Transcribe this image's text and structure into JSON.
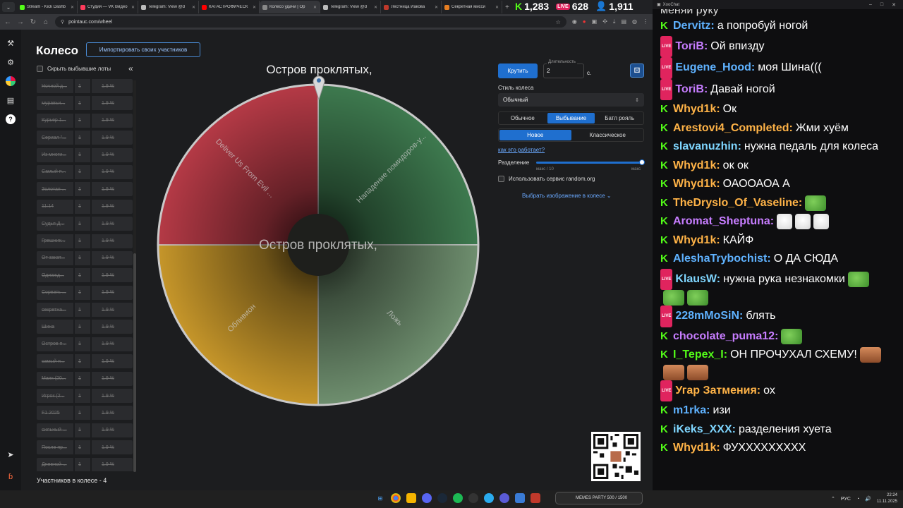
{
  "browser": {
    "tabs": [
      {
        "title": "Stream - Kick Dashb",
        "color": "#53fc18"
      },
      {
        "title": "Студия — VK Видео",
        "color": "#ff3b5c"
      },
      {
        "title": "Telegram: View @d",
        "color": "#bbbbbb"
      },
      {
        "title": "КАТАСТРОФИЧЕСК",
        "color": "#ff0000"
      },
      {
        "title": "Колесо удачи | Ор",
        "color": "#888888",
        "active": true
      },
      {
        "title": "Telegram: View @d",
        "color": "#bbbbbb"
      },
      {
        "title": "Лестница Иакова",
        "color": "#c0392b"
      },
      {
        "title": "Секретная мисси",
        "color": "#e67e22"
      }
    ],
    "url": "pointauc.com/wheel"
  },
  "stream_stats": {
    "kick_viewers": "1,283",
    "vk_viewers": "628",
    "total_viewers": "1,911"
  },
  "sidebar": {
    "page_title": "Колесо",
    "import_button": "Импортировать своих участников",
    "hide_lots_label": "Скрыть выбывшие лоты",
    "collapse_icon": "«",
    "lots": [
      {
        "name": "Ночной д...",
        "count": "1",
        "percent": "1.9 %"
      },
      {
        "name": "муравьи...",
        "count": "1",
        "percent": "1.9 %"
      },
      {
        "name": "Курьер 1...",
        "count": "1",
        "percent": "1.9 %"
      },
      {
        "name": "Сериал \"...",
        "count": "1",
        "percent": "1.9 %"
      },
      {
        "name": "Из многи...",
        "count": "1",
        "percent": "1.9 %"
      },
      {
        "name": "Самый п...",
        "count": "1",
        "percent": "1.9 %"
      },
      {
        "name": "Золотая ...",
        "count": "1",
        "percent": "1.9 %"
      },
      {
        "name": "11:14",
        "count": "1",
        "percent": "1.9 %"
      },
      {
        "name": "Судья Д...",
        "count": "1",
        "percent": "1.9 %"
      },
      {
        "name": "Грешник...",
        "count": "1",
        "percent": "1.9 %"
      },
      {
        "name": "От закат...",
        "count": "1",
        "percent": "1.9 %"
      },
      {
        "name": "Однажд...",
        "count": "1",
        "percent": "1.9 %"
      },
      {
        "name": "Сорвать ...",
        "count": "1",
        "percent": "1.9 %"
      },
      {
        "name": "секретна...",
        "count": "1",
        "percent": "1.9 %"
      },
      {
        "name": "Шина",
        "count": "1",
        "percent": "1.9 %"
      },
      {
        "name": "Остров п...",
        "count": "1",
        "percent": "1.9 %"
      },
      {
        "name": "самый п...",
        "count": "1",
        "percent": "1.9 %"
      },
      {
        "name": "Маяк (20...",
        "count": "1",
        "percent": "1.9 %"
      },
      {
        "name": "Игрок (2...",
        "count": "1",
        "percent": "1.9 %"
      },
      {
        "name": "F1 2025",
        "count": "1",
        "percent": "1.9 %"
      },
      {
        "name": "сильный ...",
        "count": "1",
        "percent": "1.9 %"
      },
      {
        "name": "После пр...",
        "count": "1",
        "percent": "1.9 %"
      },
      {
        "name": "Дневной ...",
        "count": "1",
        "percent": "1.9 %"
      }
    ],
    "participants_count": "Участников в колесе - 4"
  },
  "wheel": {
    "title": "Остров проклятых,",
    "center_text": "Остров проклятых,",
    "segments": [
      {
        "label": "Нападение помидоров-у...",
        "color": "#3e7a4f"
      },
      {
        "label": "Ложь",
        "color": "#6f8f6f"
      },
      {
        "label": "Обливион",
        "color": "#c6962a"
      },
      {
        "label": "Deliver Us From Evil ...",
        "color": "#b53a46"
      }
    ]
  },
  "controls": {
    "spin_button": "Крутить",
    "duration_label": "Длительность",
    "duration_value": "2",
    "duration_unit": "с.",
    "style_label": "Стиль колеса",
    "style_value": "Обычный",
    "modes": [
      "Обычное",
      "Выбывание",
      "Батл рояль"
    ],
    "active_mode": "Выбывание",
    "variants": [
      "Новое",
      "Классическое"
    ],
    "active_variant": "Новое",
    "how_link": "как это работает?",
    "split_label": "Разделение",
    "split_min": "макс / 10",
    "split_max": "макс",
    "split_value": 1.0,
    "random_org_label": "Использовать сервис random.org",
    "image_select": "Выбрать изображение в колесе"
  },
  "chat": {
    "window_title": "XooChat",
    "top_partial": "меняи руку",
    "messages": [
      {
        "platform": "kick",
        "user": "Dervitz",
        "color": "#5fb2ff",
        "text": "а попробуй ногой"
      },
      {
        "platform": "vk",
        "user": "ToriB",
        "color": "#c77dff",
        "text": "Ой впизду"
      },
      {
        "platform": "vk",
        "user": "Eugene_Hood",
        "color": "#5fb2ff",
        "text": "моя Шина((("
      },
      {
        "platform": "vk",
        "user": "ToriB",
        "color": "#c77dff",
        "text": "Давай ногой"
      },
      {
        "platform": "kick",
        "user": "Whyd1k",
        "color": "#ffb347",
        "text": "Ок"
      },
      {
        "platform": "kick",
        "user": "Arestovi4_Completed",
        "color": "#ffb347",
        "text": "Жми хуём"
      },
      {
        "platform": "kick",
        "user": "slavanuzhin",
        "color": "#7fd6ff",
        "text": "нужна педаль для колеса"
      },
      {
        "platform": "kick",
        "user": "Whyd1k",
        "color": "#ffb347",
        "text": "ок ок"
      },
      {
        "platform": "kick",
        "user": "Whyd1k",
        "color": "#ffb347",
        "text": "ОАООАОА А"
      },
      {
        "platform": "kick",
        "user": "TheDryslo_Of_Vaseline",
        "color": "#ffb347",
        "text": "",
        "emotes": [
          "frog"
        ]
      },
      {
        "platform": "kick",
        "user": "Aromat_Sheptuna",
        "color": "#c77dff",
        "text": "",
        "emotes": [
          "goose",
          "goose",
          "goose"
        ]
      },
      {
        "platform": "kick",
        "user": "Whyd1k",
        "color": "#ffb347",
        "text": "КАЙФ"
      },
      {
        "platform": "kick",
        "user": "AleshaTrybochist",
        "color": "#5fb2ff",
        "text": "О ДА СЮДА"
      },
      {
        "platform": "vk",
        "user": "KlausW",
        "color": "#7fd6ff",
        "text": "нужна рука незнакомки",
        "emotes": [
          "frog"
        ]
      },
      {
        "platform": "none",
        "user": "",
        "color": "#ffffff",
        "text": "",
        "emotes": [
          "frog",
          "frog"
        ]
      },
      {
        "platform": "vk",
        "user": "228mMoSiN",
        "color": "#5fb2ff",
        "text": "блять"
      },
      {
        "platform": "kick",
        "user": "chocolate_puma12",
        "color": "#c77dff",
        "text": "",
        "emotes": [
          "frog"
        ]
      },
      {
        "platform": "kick",
        "user": "I_Tepex_I",
        "color": "#53fc18",
        "text": "ОН ПРОЧУХАЛ СХЕМУ!",
        "emotes": [
          "face"
        ]
      },
      {
        "platform": "none",
        "user": "",
        "color": "#ffffff",
        "text": "",
        "emotes": [
          "face",
          "face"
        ]
      },
      {
        "platform": "vk",
        "user": "Угар Затмения",
        "color": "#ffb347",
        "text": "ох"
      },
      {
        "platform": "kick",
        "user": "m1rka",
        "color": "#5fb2ff",
        "text": "изи"
      },
      {
        "platform": "kick",
        "user": "iKeks_XXX",
        "color": "#7fd6ff",
        "text": "разделения хуета"
      },
      {
        "platform": "kick",
        "user": "Whyd1k",
        "color": "#ffb347",
        "text": "ФУХХХХХХХХХ"
      }
    ]
  },
  "taskbar": {
    "meme_widget": "MEMES PARTY  500 / 1500",
    "lang": "РУС",
    "time": "22:24",
    "date": "11.11.2025"
  }
}
